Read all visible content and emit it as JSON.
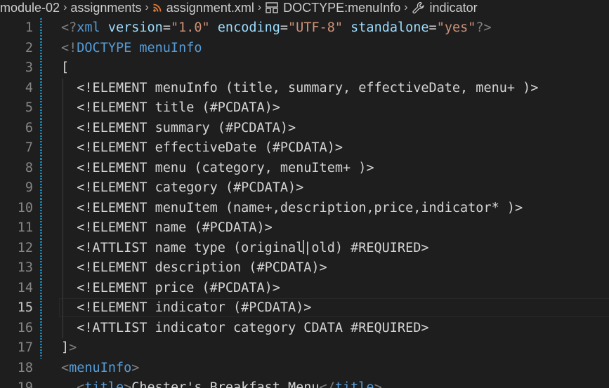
{
  "breadcrumb": {
    "items": [
      {
        "label": "module-02",
        "icon": null
      },
      {
        "label": "assignments",
        "icon": null
      },
      {
        "label": "assignment.xml",
        "icon": "rss-icon"
      },
      {
        "label": "DOCTYPE:menuInfo",
        "icon": "symbol-structure-icon"
      },
      {
        "label": "indicator",
        "icon": "wrench-icon"
      }
    ],
    "separator": "›"
  },
  "editor": {
    "current_line": 15,
    "modified_lines": [
      1,
      2,
      3,
      4,
      5,
      6,
      7,
      8,
      9,
      10,
      11,
      12,
      13,
      14,
      15,
      16,
      17
    ],
    "lines": [
      {
        "num": "1",
        "tokens": [
          {
            "t": "<?",
            "c": "punct"
          },
          {
            "t": "xml",
            "c": "tag"
          },
          {
            "t": " ",
            "c": "text"
          },
          {
            "t": "version",
            "c": "attr"
          },
          {
            "t": "=",
            "c": "text"
          },
          {
            "t": "\"1.0\"",
            "c": "str"
          },
          {
            "t": " ",
            "c": "text"
          },
          {
            "t": "encoding",
            "c": "attr"
          },
          {
            "t": "=",
            "c": "text"
          },
          {
            "t": "\"UTF-8\"",
            "c": "str"
          },
          {
            "t": " ",
            "c": "text"
          },
          {
            "t": "standalone",
            "c": "attr"
          },
          {
            "t": "=",
            "c": "text"
          },
          {
            "t": "\"yes\"",
            "c": "str"
          },
          {
            "t": "?>",
            "c": "punct"
          }
        ]
      },
      {
        "num": "2",
        "tokens": [
          {
            "t": "<!",
            "c": "punct"
          },
          {
            "t": "DOCTYPE menuInfo",
            "c": "tag"
          }
        ]
      },
      {
        "num": "3",
        "tokens": [
          {
            "t": "[",
            "c": "text"
          }
        ]
      },
      {
        "num": "4",
        "indent": true,
        "tokens": [
          {
            "t": "  <!ELEMENT menuInfo (title, summary, effectiveDate, menu+ )>",
            "c": "text"
          }
        ]
      },
      {
        "num": "5",
        "indent": true,
        "tokens": [
          {
            "t": "  <!ELEMENT title (#PCDATA)>",
            "c": "text"
          }
        ]
      },
      {
        "num": "6",
        "indent": true,
        "tokens": [
          {
            "t": "  <!ELEMENT summary (#PCDATA)>",
            "c": "text"
          }
        ]
      },
      {
        "num": "7",
        "indent": true,
        "tokens": [
          {
            "t": "  <!ELEMENT effectiveDate (#PCDATA)>",
            "c": "text"
          }
        ]
      },
      {
        "num": "8",
        "indent": true,
        "tokens": [
          {
            "t": "  <!ELEMENT menu (category, menuItem+ )>",
            "c": "text"
          }
        ]
      },
      {
        "num": "9",
        "indent": true,
        "tokens": [
          {
            "t": "  <!ELEMENT category (#PCDATA)>",
            "c": "text"
          }
        ]
      },
      {
        "num": "10",
        "indent": true,
        "tokens": [
          {
            "t": "  <!ELEMENT menuItem (name+,description,price,indicator* )>",
            "c": "text"
          }
        ]
      },
      {
        "num": "11",
        "indent": true,
        "tokens": [
          {
            "t": "  <!ELEMENT name (#PCDATA)>",
            "c": "text"
          }
        ]
      },
      {
        "num": "12",
        "indent": true,
        "cursor_after": "  <!ATTLIST name type (original",
        "tokens": [
          {
            "t": "  <!ATTLIST name type (original",
            "c": "text"
          },
          {
            "t": "|old) #REQUIRED>",
            "c": "text"
          }
        ]
      },
      {
        "num": "13",
        "indent": true,
        "tokens": [
          {
            "t": "  <!ELEMENT description (#PCDATA)>",
            "c": "text"
          }
        ]
      },
      {
        "num": "14",
        "indent": true,
        "tokens": [
          {
            "t": "  <!ELEMENT price (#PCDATA)>",
            "c": "text"
          }
        ]
      },
      {
        "num": "15",
        "indent": true,
        "tokens": [
          {
            "t": "  <!ELEMENT indicator (#PCDATA)>",
            "c": "text"
          }
        ]
      },
      {
        "num": "16",
        "indent": true,
        "tokens": [
          {
            "t": "  <!ATTLIST indicator category CDATA #REQUIRED>",
            "c": "text"
          }
        ]
      },
      {
        "num": "17",
        "tokens": [
          {
            "t": "]",
            "c": "text"
          },
          {
            "t": ">",
            "c": "punct"
          }
        ]
      },
      {
        "num": "18",
        "tokens": [
          {
            "t": "<",
            "c": "punct"
          },
          {
            "t": "menuInfo",
            "c": "tag"
          },
          {
            "t": ">",
            "c": "punct"
          }
        ]
      },
      {
        "num": "19",
        "tokens": [
          {
            "t": "  <",
            "c": "punct"
          },
          {
            "t": "title",
            "c": "tag"
          },
          {
            "t": ">",
            "c": "punct"
          },
          {
            "t": "Chester's Breakfast Menu",
            "c": "text"
          },
          {
            "t": "</",
            "c": "punct"
          },
          {
            "t": "title",
            "c": "tag"
          },
          {
            "t": ">",
            "c": "punct"
          }
        ]
      }
    ]
  },
  "colors": {
    "background": "#1e1e1e",
    "modified_gutter": "#1b81a8"
  }
}
